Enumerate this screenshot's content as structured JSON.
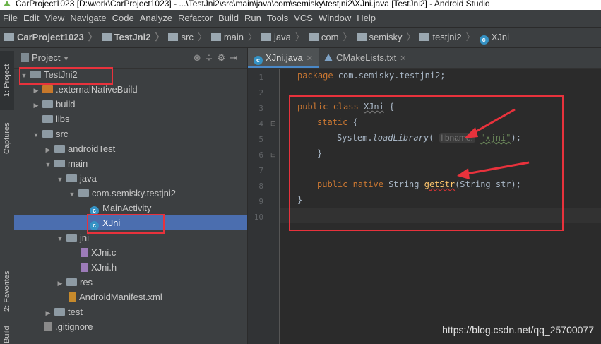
{
  "window": {
    "title": "CarProject1023 [D:\\work\\CarProject1023] - ...\\TestJni2\\src\\main\\java\\com\\semisky\\testjni2\\XJni.java [TestJni2] - Android Studio"
  },
  "menu": [
    "File",
    "Edit",
    "View",
    "Navigate",
    "Code",
    "Analyze",
    "Refactor",
    "Build",
    "Run",
    "Tools",
    "VCS",
    "Window",
    "Help"
  ],
  "breadcrumbs": [
    "CarProject1023",
    "TestJni2",
    "src",
    "main",
    "java",
    "com",
    "semisky",
    "testjni2",
    "XJni"
  ],
  "tool_windows": {
    "project": "1: Project",
    "captures": "Captures",
    "favorites": "2: Favorites",
    "build": "Build"
  },
  "project_panel": {
    "header": "Project",
    "tree": [
      {
        "label": "TestJni2",
        "depth": 0,
        "expanded": true,
        "icon": "module-folder-icon"
      },
      {
        "label": ".externalNativeBuild",
        "depth": 1,
        "expanded": false,
        "icon": "build-folder-icon"
      },
      {
        "label": "build",
        "depth": 1,
        "expanded": false,
        "icon": "folder-icon"
      },
      {
        "label": "libs",
        "depth": 1,
        "expanded": null,
        "icon": "folder-icon"
      },
      {
        "label": "src",
        "depth": 1,
        "expanded": true,
        "icon": "folder-icon"
      },
      {
        "label": "androidTest",
        "depth": 2,
        "expanded": false,
        "icon": "folder-icon"
      },
      {
        "label": "main",
        "depth": 2,
        "expanded": true,
        "icon": "folder-icon"
      },
      {
        "label": "java",
        "depth": 3,
        "expanded": true,
        "icon": "folder-icon"
      },
      {
        "label": "com.semisky.testjni2",
        "depth": 4,
        "expanded": true,
        "icon": "package-icon"
      },
      {
        "label": "MainActivity",
        "depth": 5,
        "expanded": null,
        "icon": "class-icon"
      },
      {
        "label": "XJni",
        "depth": 5,
        "expanded": null,
        "icon": "class-icon",
        "selected": true
      },
      {
        "label": "jni",
        "depth": 3,
        "expanded": true,
        "icon": "folder-icon"
      },
      {
        "label": "XJni.c",
        "depth": 4,
        "expanded": null,
        "icon": "c-file-icon"
      },
      {
        "label": "XJni.h",
        "depth": 4,
        "expanded": null,
        "icon": "c-file-icon"
      },
      {
        "label": "res",
        "depth": 3,
        "expanded": false,
        "icon": "folder-icon"
      },
      {
        "label": "AndroidManifest.xml",
        "depth": 3,
        "expanded": null,
        "icon": "xml-file-icon"
      },
      {
        "label": "test",
        "depth": 2,
        "expanded": false,
        "icon": "folder-icon"
      },
      {
        "label": ".gitignore",
        "depth": 1,
        "expanded": null,
        "icon": "git-file-icon"
      }
    ]
  },
  "editor": {
    "tabs": [
      {
        "label": "XJni.java",
        "active": true
      },
      {
        "label": "CMakeLists.txt",
        "active": false
      }
    ],
    "line_numbers": [
      "1",
      "2",
      "3",
      "4",
      "5",
      "6",
      "7",
      "8",
      "9",
      "10"
    ],
    "code": {
      "l1_kw": "package",
      "l1_rest": " com.semisky.testjni2;",
      "l3_kw": "public class",
      "l3_cls": "XJni",
      "l3_rest": " {",
      "l4_kw": "static",
      "l4_rest": " {",
      "l5_a": "System.",
      "l5_b": "loadLibrary",
      "l5_c": "(",
      "l5_hint": "libname:",
      "l5_str": "\"xjni\"",
      "l5_d": ");",
      "l6": "}",
      "l8_kw": "public native",
      "l8_type": " String ",
      "l8_fn": "getStr",
      "l8_rest": "(String str);",
      "l9": "}"
    }
  },
  "watermark": "https://blog.csdn.net/qq_25700077"
}
